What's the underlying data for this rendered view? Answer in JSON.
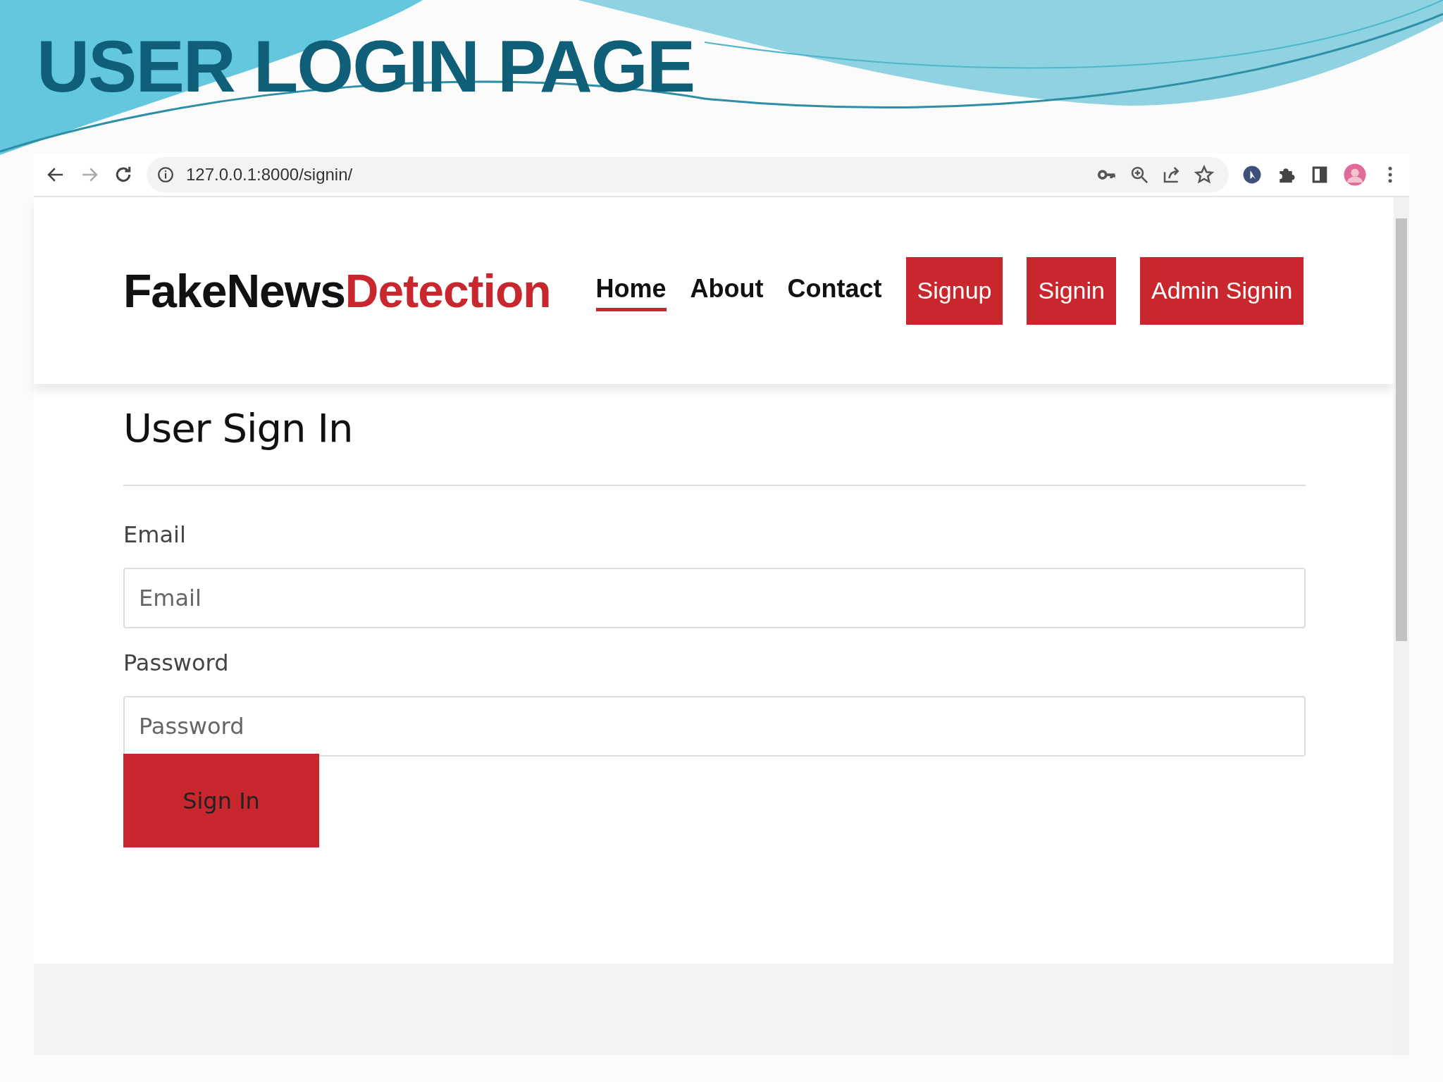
{
  "slide": {
    "title": "USER LOGIN PAGE"
  },
  "browser": {
    "url": "127.0.0.1:8000/signin/"
  },
  "navbar": {
    "brand": {
      "dark": "FakeNews",
      "accent": "Detection"
    },
    "items": [
      {
        "label": "Home",
        "kind": "link",
        "selected": true
      },
      {
        "label": "About",
        "kind": "link",
        "selected": false
      },
      {
        "label": "Contact",
        "kind": "link",
        "selected": false
      },
      {
        "label": "Signup",
        "kind": "button",
        "selected": false
      },
      {
        "label": "Signin",
        "kind": "button",
        "selected": false
      },
      {
        "label": "Admin Signin",
        "kind": "button",
        "selected": false
      }
    ]
  },
  "form": {
    "heading": "User Sign In",
    "fields": [
      {
        "label": "Email",
        "placeholder": "Email"
      },
      {
        "label": "Password",
        "placeholder": "Password"
      }
    ],
    "submit": "Sign In"
  }
}
